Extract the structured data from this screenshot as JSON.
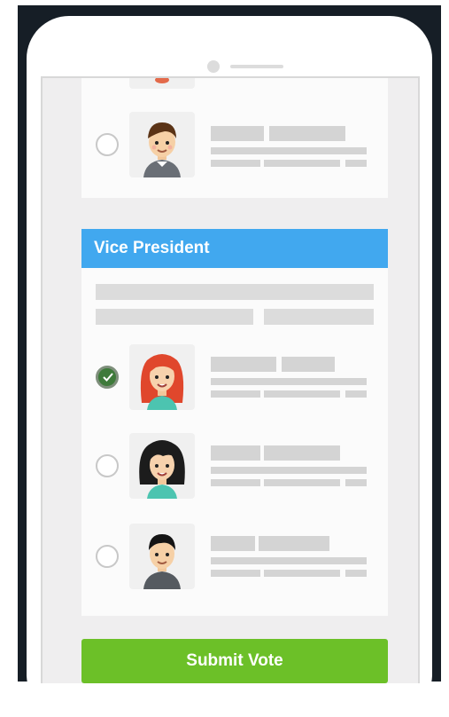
{
  "vice_president": {
    "section_title": "Vice President",
    "candidates": [
      {
        "selected": true,
        "avatar_icon": "redhead-woman-avatar-icon"
      },
      {
        "selected": false,
        "avatar_icon": "dark-hair-woman-avatar-icon"
      },
      {
        "selected": false,
        "avatar_icon": "dark-hair-man-avatar-icon"
      }
    ]
  },
  "previous_section": {
    "candidates": [
      {
        "selected": false,
        "avatar_icon": "brown-hair-man-avatar-icon"
      }
    ]
  },
  "submit": {
    "label": "Submit Vote"
  },
  "colors": {
    "header": "#41a8ef",
    "submit": "#6cc028",
    "selected_radio": "#3e7a3a",
    "frame": "#161e26"
  }
}
